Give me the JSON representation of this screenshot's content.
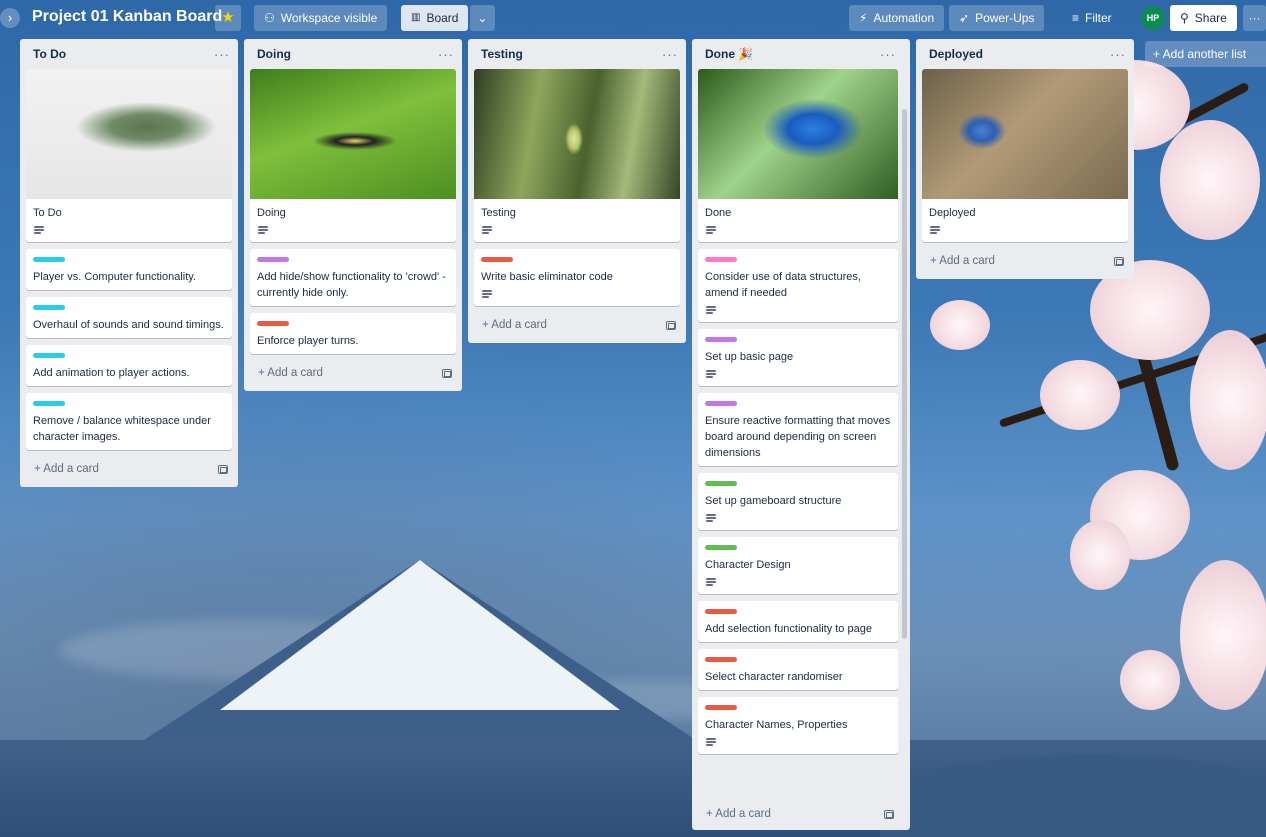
{
  "board": {
    "title": "Project 01 Kanban Board",
    "visibility": "Workspace visible",
    "view": "Board",
    "starred": true
  },
  "header_right": {
    "automation": "Automation",
    "powerups": "Power-Ups",
    "filter": "Filter",
    "avatar_initials": "HP",
    "share": "Share"
  },
  "icons": {
    "sidebar_toggle": "chevron-right-icon",
    "star": "star-icon",
    "visibility": "people-icon",
    "board": "board-icon",
    "dropdown": "chevron-down-icon",
    "automation": "lightning-icon",
    "powerups": "rocket-icon",
    "filter": "filter-icon",
    "share": "add-user-icon",
    "more": "more-icon"
  },
  "label_colors": {
    "cyan": "#29cce5",
    "purple": "#c377e0",
    "red": "#eb5a46",
    "pink": "#ff78cb",
    "green": "#61bd4f"
  },
  "lists": {
    "todo": {
      "title": "To Do",
      "cover_card": "To Do",
      "cards": [
        "Player vs. Computer functionality.",
        "Overhaul of sounds and sound timings.",
        "Add animation to player actions.",
        "Remove / balance whitespace under character images."
      ],
      "add_card": "+ Add a card"
    },
    "doing": {
      "title": "Doing",
      "cover_card": "Doing",
      "cards": [
        "Add hide/show functionality to 'crowd' - currently hide only.",
        "Enforce player turns."
      ],
      "add_card": "+ Add a card"
    },
    "testing": {
      "title": "Testing",
      "cover_card": "Testing",
      "cards": [
        "Write basic eliminator code"
      ],
      "add_card": "+ Add a card"
    },
    "done": {
      "title": "Done 🎉",
      "cover_card": "Done",
      "cards": [
        "Consider use of data structures, amend if needed",
        "Set up basic page",
        "Ensure reactive formatting that moves board around depending on screen dimensions",
        "Set up gameboard structure",
        "Character Design",
        "Add selection functionality to page",
        "Select character randomiser",
        "Character Names, Properties"
      ],
      "add_card": "+ Add a card"
    },
    "deployed": {
      "title": "Deployed",
      "cover_card": "Deployed",
      "add_card": "+ Add a card"
    }
  },
  "add_list": "+ Add another list"
}
